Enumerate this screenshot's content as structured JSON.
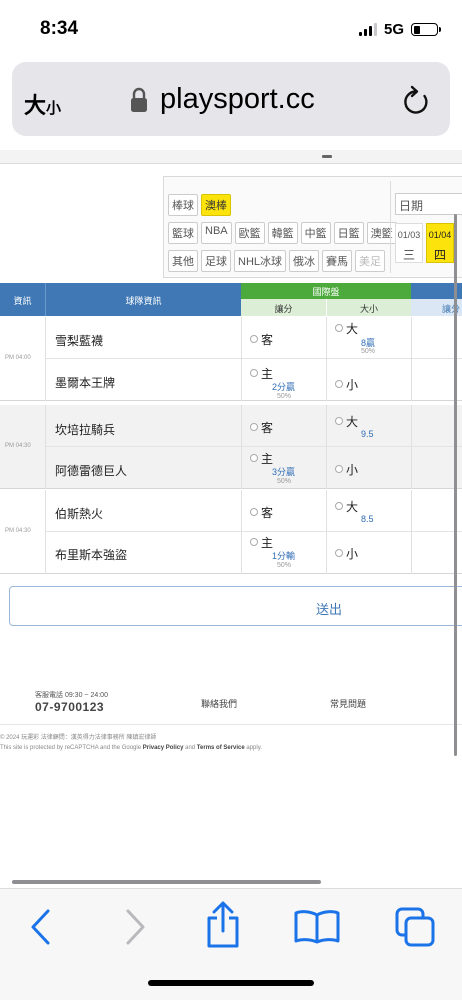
{
  "status_bar": {
    "time": "8:34",
    "network": "5G",
    "signal_bars": 3,
    "battery_level": 0.3
  },
  "browser": {
    "text_size_large": "大",
    "text_size_small": "小",
    "url": "playsport.cc"
  },
  "filters": {
    "row1": [
      {
        "label": "棒球",
        "selected": false
      },
      {
        "label": "澳棒",
        "selected": true
      }
    ],
    "row2": [
      {
        "label": "籃球"
      },
      {
        "label": "NBA"
      },
      {
        "label": "歐籃"
      },
      {
        "label": "韓籃"
      },
      {
        "label": "中籃"
      },
      {
        "label": "日籃"
      },
      {
        "label": "澳籃"
      }
    ],
    "row3": [
      {
        "label": "其他"
      },
      {
        "label": "足球"
      },
      {
        "label": "NHL冰球"
      },
      {
        "label": "俄冰"
      },
      {
        "label": "賽馬"
      },
      {
        "label": "美足"
      }
    ],
    "date_label": "日期",
    "dates": [
      {
        "date": "01/03",
        "weekday": "三",
        "selected": false
      },
      {
        "date": "01/04",
        "weekday": "四",
        "selected": true
      }
    ]
  },
  "table": {
    "headers": {
      "info": "資訊",
      "team": "球隊資訊",
      "intl": "國際盤",
      "handicap": "讓分",
      "total": "大小",
      "more": "讓分"
    },
    "home_label": "主",
    "away_label": "客",
    "over_label": "大",
    "under_label": "小",
    "games": [
      {
        "time": "PM 04:00",
        "away_team": "雪梨藍襪",
        "home_team": "墨爾本王牌",
        "handicap_value": "2分贏",
        "handicap_pct": "50%",
        "total_value": "8贏",
        "total_pct": "50%"
      },
      {
        "time": "PM 04:30",
        "away_team": "坎培拉騎兵",
        "home_team": "阿德雷德巨人",
        "handicap_value": "3分贏",
        "handicap_pct": "50%",
        "total_value": "9.5",
        "total_pct": ""
      },
      {
        "time": "PM 04:30",
        "away_team": "伯斯熱火",
        "home_team": "布里斯本強盜",
        "handicap_value": "1分輸",
        "handicap_pct": "50%",
        "total_value": "8.5",
        "total_pct": ""
      }
    ]
  },
  "submit_label": "送出",
  "footer": {
    "service_hours": "客服電話 09:30 ~ 24:00",
    "phone": "07-9700123",
    "contact": "聯絡我們",
    "faq": "常見問題",
    "copyright": "© 2024 玩運彩 法律顧問：漢英得力法律事務所 陳鎮宏律師",
    "recaptcha_prefix": "This site is protected by reCAPTCHA and the Google ",
    "privacy": "Privacy Policy",
    "and": " and ",
    "terms": "Terms of Service",
    "apply": " apply."
  },
  "toolbar": {
    "back": "back-icon",
    "forward": "forward-icon",
    "share": "share-icon",
    "bookmarks": "bookmarks-icon",
    "tabs": "tabs-icon"
  }
}
